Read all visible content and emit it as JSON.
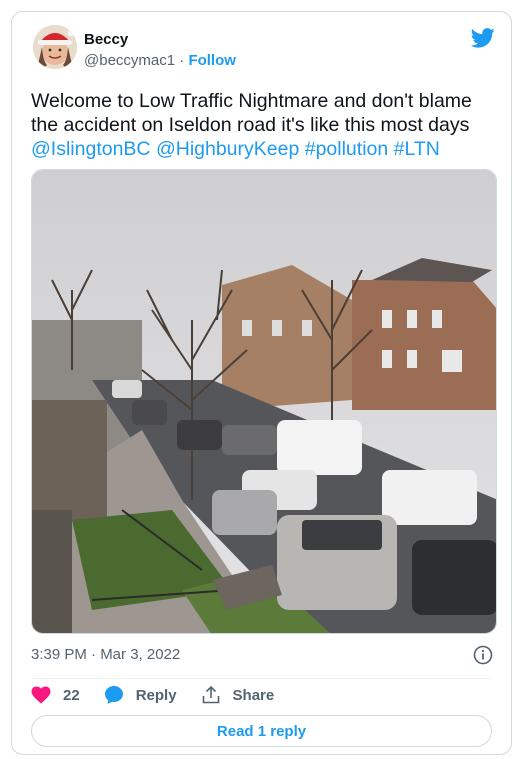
{
  "author": {
    "name": "Beccy",
    "handle": "@beccymac1",
    "separator": "·",
    "follow_label": "Follow"
  },
  "tweet": {
    "text": "Welcome to Low Traffic Nightmare and don't blame the accident on Iseldon road it's like this most days",
    "tags": [
      "@IslingtonBC",
      "@HighburyKeep",
      "#pollution",
      "#LTN"
    ],
    "timestamp": "3:39 PM · Mar 3, 2022"
  },
  "actions": {
    "like_count": "22",
    "reply_label": "Reply",
    "share_label": "Share"
  },
  "read_replies_label": "Read 1 reply",
  "colors": {
    "accent": "#1d9bf0",
    "heart": "#f91880",
    "muted": "#536471",
    "border": "#cfd9de"
  },
  "icons": [
    "twitter-bird-icon",
    "info-icon",
    "heart-icon",
    "reply-icon",
    "share-icon"
  ]
}
